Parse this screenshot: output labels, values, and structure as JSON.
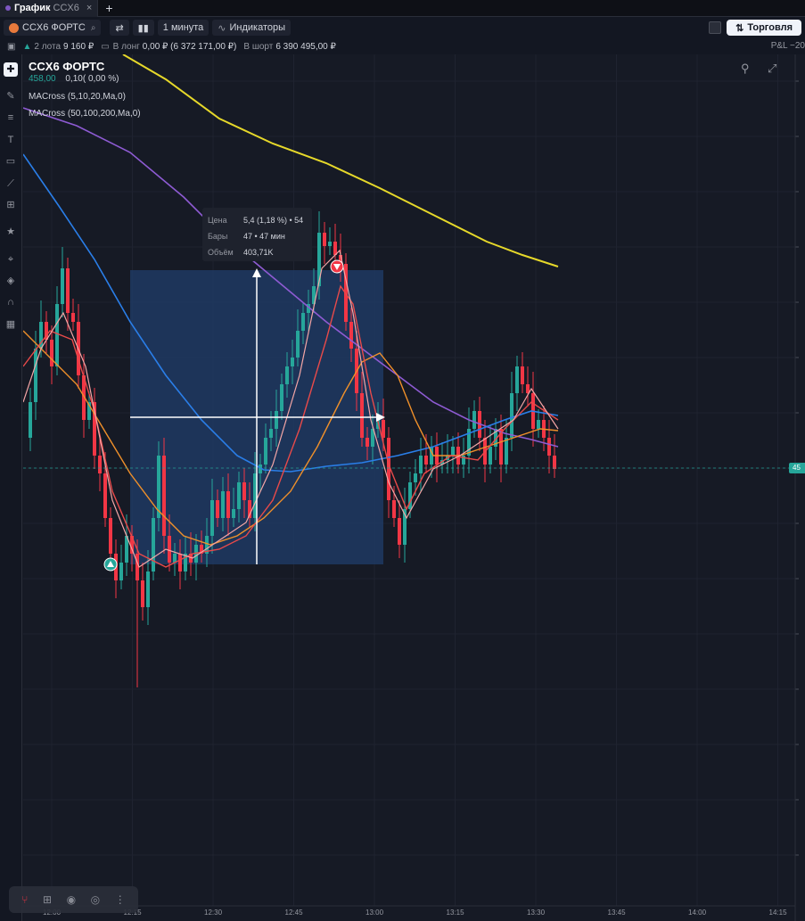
{
  "tab": {
    "label": "График",
    "symbol": "CCX6",
    "close": "×",
    "add": "+"
  },
  "toolbar": {
    "symbol": "CCX6 ФОРТС",
    "interval": "1 минута",
    "indicators": "Индикаторы",
    "trade": "Торговля"
  },
  "info": {
    "lots_label": "2 лота",
    "lots_value": "9 160 ₽",
    "long_label": "В лонг",
    "long_value": "0,00 ₽ (6 372 171,00 ₽)",
    "short_label": "В шорт",
    "short_value": "6 390 495,00 ₽",
    "pnl": "P&L −20"
  },
  "legend": {
    "title": "CCX6 ФОРТС",
    "price": "458,00",
    "change": "0,10( 0,00 %)",
    "ind1": "MACross (5,10,20,Ma,0)",
    "ind2": "MACross (50,100,200,Ma,0)"
  },
  "measure": {
    "price_label": "Цена",
    "price_value": "5,4 (1,18 %) • 54",
    "bars_label": "Бары",
    "bars_value": "47 • 47 мин",
    "volume_label": "Объём",
    "volume_value": "403,71K"
  },
  "price_tag": "45",
  "x_axis": [
    "12:00",
    "12:15",
    "12:30",
    "12:45",
    "13:00",
    "13:15",
    "13:30",
    "13:45",
    "14:00",
    "14:15"
  ],
  "colors": {
    "up": "#26a69a",
    "down": "#f23645",
    "bg": "#161a25",
    "ma200": "#e6d82a",
    "ma100": "#8e5bd3",
    "ma50": "#2a7ee8"
  },
  "chart_data": {
    "type": "candlestick",
    "interval": "1 minute",
    "note_series": [
      "MA5",
      "MA10",
      "MA20",
      "MA50",
      "MA100",
      "MA200"
    ]
  }
}
